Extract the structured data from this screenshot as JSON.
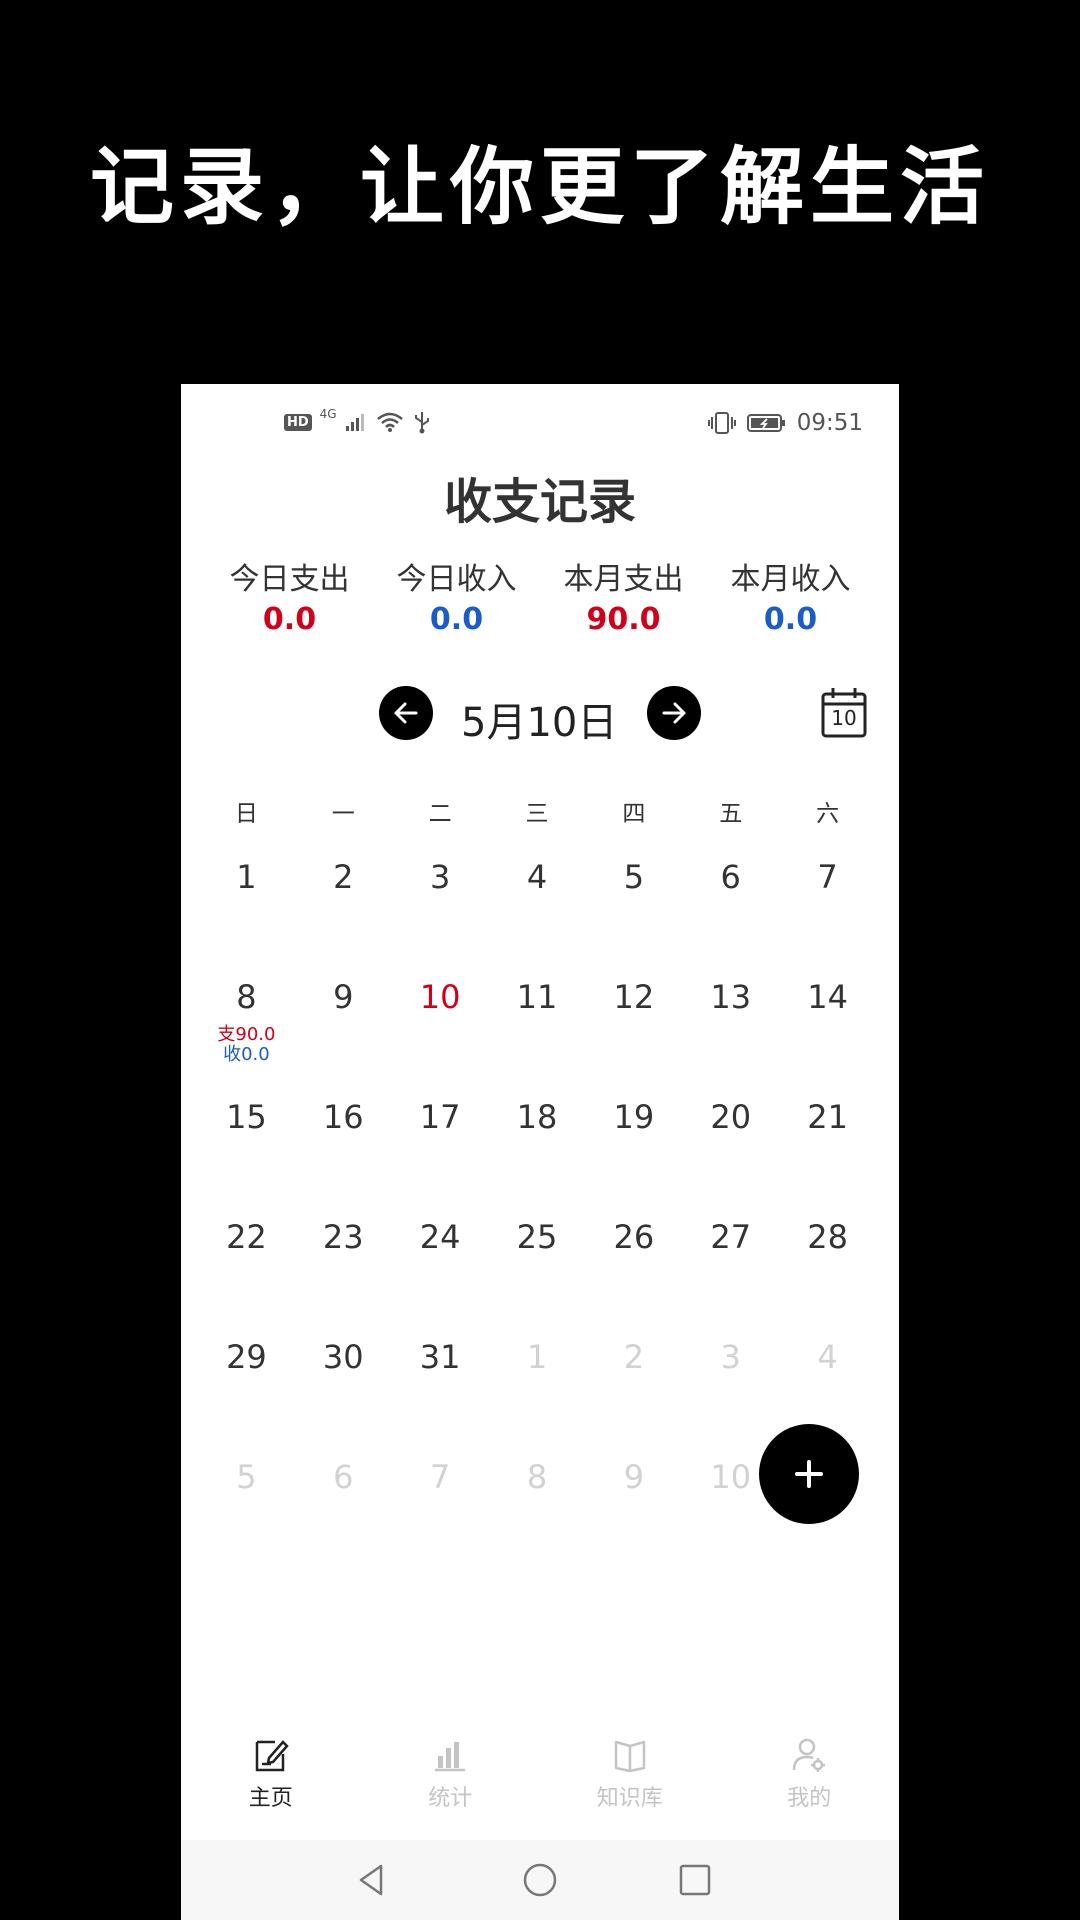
{
  "headline": "记录，让你更了解生活",
  "status_bar": {
    "left_badges": [
      "HD",
      "4G"
    ],
    "time": "09:51"
  },
  "app_title": "收支记录",
  "summary": [
    {
      "label": "今日支出",
      "value": "0.0",
      "color": "#d0021b"
    },
    {
      "label": "今日收入",
      "value": "0.0",
      "color": "#1b5cc8"
    },
    {
      "label": "本月支出",
      "value": "90.0",
      "color": "#d0021b"
    },
    {
      "label": "本月收入",
      "value": "0.0",
      "color": "#1b5cc8"
    }
  ],
  "date_nav": {
    "current_date": "5月10日",
    "calendar_day_number": "10"
  },
  "weekdays": [
    "日",
    "一",
    "二",
    "三",
    "四",
    "五",
    "六"
  ],
  "calendar": {
    "weeks": [
      [
        {
          "d": "1"
        },
        {
          "d": "2"
        },
        {
          "d": "3"
        },
        {
          "d": "4"
        },
        {
          "d": "5"
        },
        {
          "d": "6"
        },
        {
          "d": "7"
        }
      ],
      [
        {
          "d": "8",
          "expense": "支90.0",
          "income": "收0.0"
        },
        {
          "d": "9"
        },
        {
          "d": "10",
          "today": true
        },
        {
          "d": "11"
        },
        {
          "d": "12"
        },
        {
          "d": "13"
        },
        {
          "d": "14"
        }
      ],
      [
        {
          "d": "15"
        },
        {
          "d": "16"
        },
        {
          "d": "17"
        },
        {
          "d": "18"
        },
        {
          "d": "19"
        },
        {
          "d": "20"
        },
        {
          "d": "21"
        }
      ],
      [
        {
          "d": "22"
        },
        {
          "d": "23"
        },
        {
          "d": "24"
        },
        {
          "d": "25"
        },
        {
          "d": "26"
        },
        {
          "d": "27"
        },
        {
          "d": "28"
        }
      ],
      [
        {
          "d": "29"
        },
        {
          "d": "30"
        },
        {
          "d": "31"
        },
        {
          "d": "1",
          "other": true
        },
        {
          "d": "2",
          "other": true
        },
        {
          "d": "3",
          "other": true
        },
        {
          "d": "4",
          "other": true
        }
      ],
      [
        {
          "d": "5",
          "other": true
        },
        {
          "d": "6",
          "other": true
        },
        {
          "d": "7",
          "other": true
        },
        {
          "d": "8",
          "other": true
        },
        {
          "d": "9",
          "other": true
        },
        {
          "d": "10",
          "other": true
        }
      ]
    ]
  },
  "tabs": [
    {
      "label": "主页",
      "icon": "edit-note-icon",
      "active": true
    },
    {
      "label": "统计",
      "icon": "bar-chart-icon",
      "active": false
    },
    {
      "label": "知识库",
      "icon": "book-icon",
      "active": false
    },
    {
      "label": "我的",
      "icon": "user-settings-icon",
      "active": false
    }
  ],
  "colors": {
    "expense": "#d0021b",
    "income": "#1b5cc8",
    "today": "#d0021b",
    "accent": "#000000"
  }
}
